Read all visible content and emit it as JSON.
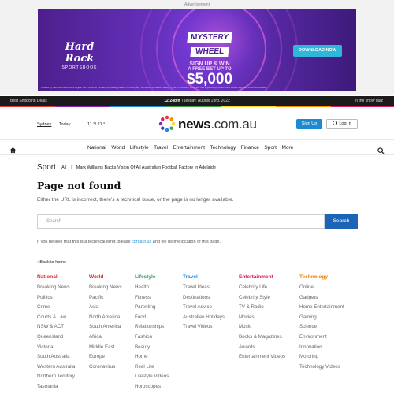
{
  "ad": {
    "label": "Advertisement",
    "brand_line1": "Hard Rock",
    "brand_line2": "SPORTSBOOK",
    "promo_line1": "MYSTERY",
    "promo_line2": "WHEEL",
    "promo_line3": "SIGN UP & WIN",
    "promo_line4": "A FREE BET UP TO",
    "promo_amount": "$5,000",
    "cta": "DOWNLOAD NOW",
    "fine_print": "Offered by Seminole Hard Rock Digital, LLC. Must be 21+ and physically present in NJ to play. Terms and conditions apply. If you or someone you know has a gambling problem and wants help, call 1-800-GAMBLER."
  },
  "topbar": {
    "left": "Best Shopping Deals",
    "time": "12:24pm",
    "date": "Tuesday, August 23rd, 2022",
    "right": "In the know quiz"
  },
  "header": {
    "city": "Sydney",
    "day": "Today",
    "temps": "11 °/ 21 °",
    "logo_main": "news",
    "logo_domain": ".com.au",
    "signup": "Sign Up",
    "login": "Log In"
  },
  "nav": {
    "items": [
      "National",
      "World",
      "Lifestyle",
      "Travel",
      "Entertainment",
      "Technology",
      "Finance",
      "Sport",
      "More"
    ]
  },
  "breadcrumb": {
    "section": "Sport",
    "all": "All",
    "article": "Mark Williams Backs Vision Of All Australian Football Factory In Adelaide"
  },
  "page": {
    "title": "Page not found",
    "description": "Either the URL is incorrect, there's a technical issue, or the page is no longer available.",
    "search_placeholder": "Search",
    "search_button": "Search",
    "contact_before": "If you believe that this is a technical error, please",
    "contact_link": "contact us",
    "contact_after": "and tell us the location of this page.",
    "back": "Back to home"
  },
  "colors": {
    "national": "#d32f2f",
    "world": "#c62828",
    "lifestyle": "#2e9e5b",
    "travel": "#1e88e5",
    "entertainment": "#d81b60",
    "technology": "#f57c00"
  },
  "columns": [
    {
      "heading": "National",
      "links": [
        "Breaking News",
        "Politics",
        "Crime",
        "Courts & Law",
        "NSW & ACT",
        "Queensland",
        "Victoria",
        "South Australia",
        "Western Australia",
        "Northern Territory",
        "Tasmania"
      ]
    },
    {
      "heading": "World",
      "links": [
        "Breaking News",
        "Pacific",
        "Asia",
        "North America",
        "South America",
        "Africa",
        "Middle East",
        "Europe",
        "Coronavirus"
      ]
    },
    {
      "heading": "Lifestyle",
      "links": [
        "Health",
        "Fitness",
        "Parenting",
        "Food",
        "Relationships",
        "Fashion",
        "Beauty",
        "Home",
        "Real Life",
        "Lifestyle Videos",
        "Horoscopes"
      ]
    },
    {
      "heading": "Travel",
      "links": [
        "Travel Ideas",
        "Destinations",
        "Travel Advice",
        "Australian Holidays",
        "Travel Videos"
      ]
    },
    {
      "heading": "Entertainment",
      "links": [
        "Celebrity Life",
        "Celebrity Style",
        "TV & Radio",
        "Movies",
        "Music",
        "Books & Magazines",
        "Awards",
        "Entertainment Videos"
      ]
    },
    {
      "heading": "Technology",
      "links": [
        "Online",
        "Gadgets",
        "Home Entertainment",
        "Gaming",
        "Science",
        "Environment",
        "Innovation",
        "Motoring",
        "Technology Videos"
      ]
    }
  ]
}
